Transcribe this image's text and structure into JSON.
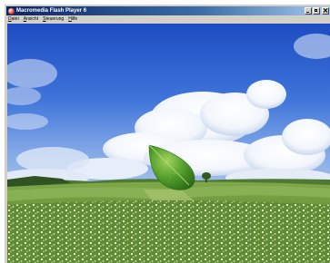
{
  "window": {
    "title": "Macromedia Flash Player 6",
    "icon": "flash-player-icon",
    "controls": [
      "minimize-icon",
      "maximize-icon",
      "close-icon"
    ]
  },
  "menubar": {
    "items": [
      {
        "label": "Datei",
        "accel": "D",
        "rest": "atei"
      },
      {
        "label": "Ansicht",
        "accel": "A",
        "rest": "nsicht"
      },
      {
        "label": "Steuerung",
        "accel": "S",
        "rest": "teuerung"
      },
      {
        "label": "Hilfe",
        "accel": "H",
        "rest": "ilfe"
      }
    ]
  },
  "stage": {
    "scene": "green leaf floating over a flowering potato field under a blue sky with cumulus clouds",
    "colors": {
      "sky_top": "#1f4fc4",
      "sky_bottom": "#8fb4ea",
      "field": "#6f9a3c",
      "leaf": "#4f9a2a"
    }
  }
}
